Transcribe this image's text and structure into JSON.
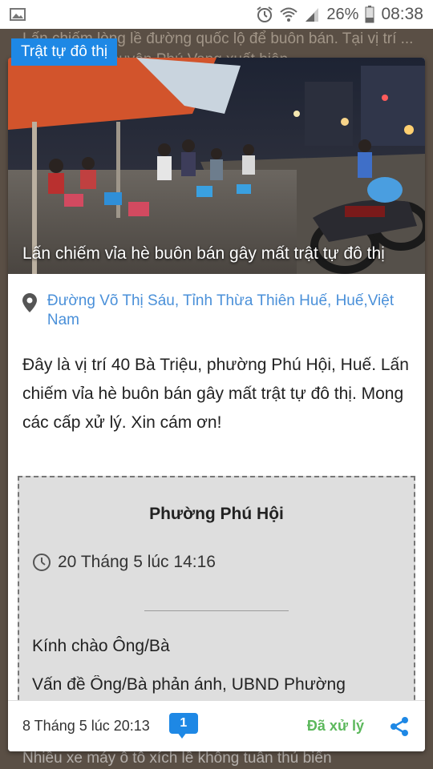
{
  "status_bar": {
    "battery_percent": "26%",
    "time": "08:38",
    "icons": [
      "image-icon",
      "alarm-icon",
      "wifi-icon",
      "signal-icon",
      "battery-icon"
    ]
  },
  "background": {
    "top_text": "Lấn chiếm lòng lề đường quốc lộ để buôn bán. Tại vị trí ... Phú Dương, huyện Phú Vang xuất hiện",
    "bottom_text": "Nhiều xe máy ô tô xích lề không tuân thủ biển"
  },
  "card": {
    "category": "Trật tự đô thị",
    "image_caption": "Lấn chiếm vỉa hè buôn bán gây mất trật tự đô thị",
    "location": "Đường Võ Thị Sáu, Tỉnh Thừa Thiên Huế, Huế,Việt Nam",
    "description": "Đây là vị trí 40 Bà Triệu, phường Phú Hội, Huế. Lấn chiếm vỉa hè buôn bán gây mất trật tự đô thị. Mong các cấp xử lý. Xin cám ơn!",
    "response": {
      "organization": "Phường Phú Hội",
      "datetime": "20 Tháng 5 lúc 14:16",
      "greeting": "Kính chào Ông/Bà",
      "body": "Vấn đề Ông/Bà phản ánh, UBND Phường"
    },
    "footer": {
      "posted_at": "8 Tháng 5 lúc 20:13",
      "comment_count": "1",
      "status": "Đã xử lý"
    }
  },
  "colors": {
    "accent_blue": "#1e88e5",
    "link_blue": "#4a90d9",
    "status_green": "#5cb85c",
    "response_bg": "#dedede"
  }
}
